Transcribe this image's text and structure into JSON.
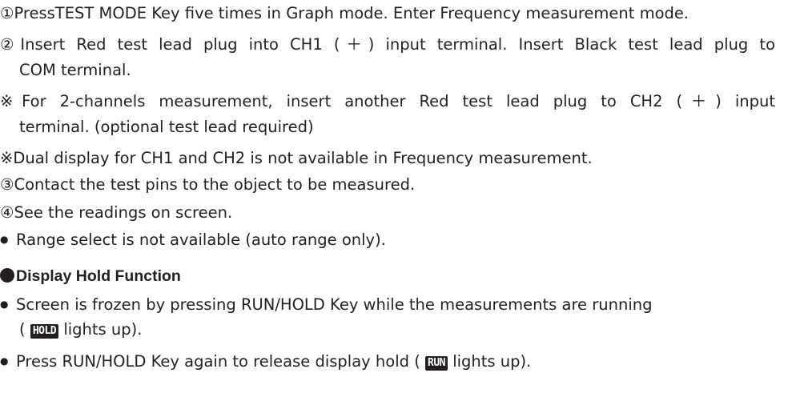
{
  "steps": {
    "s1": "①PressTEST MODE Key five times in Graph mode. Enter Frequency measurement mode.",
    "s2a": "②Insert Red test lead plug into CH1 (＋) input terminal. Insert Black test lead plug to",
    "s2b": "COM terminal.",
    "note1a": "※For 2-channels measurement, insert another Red test lead plug to CH2 (＋) input",
    "note1b": "terminal. (optional test lead required)",
    "note2": "※Dual display for CH1 and CH2 is not available in Frequency measurement.",
    "s3": "③Contact the test pins to the object to be measured.",
    "s4": "④See the readings on screen.",
    "range": "Range select is not available (auto range only)."
  },
  "hold_section": {
    "heading": "Display Hold Function",
    "item1a": "Screen is frozen by pressing RUN/HOLD Key while the measurements are running",
    "item1b_pre": "(",
    "item1b_post": "lights up).",
    "item2_pre": "Press RUN/HOLD Key again to release display hold (",
    "item2_post": "lights up).",
    "hold_icon_text": "HOLD",
    "run_icon_text": "RUN"
  }
}
